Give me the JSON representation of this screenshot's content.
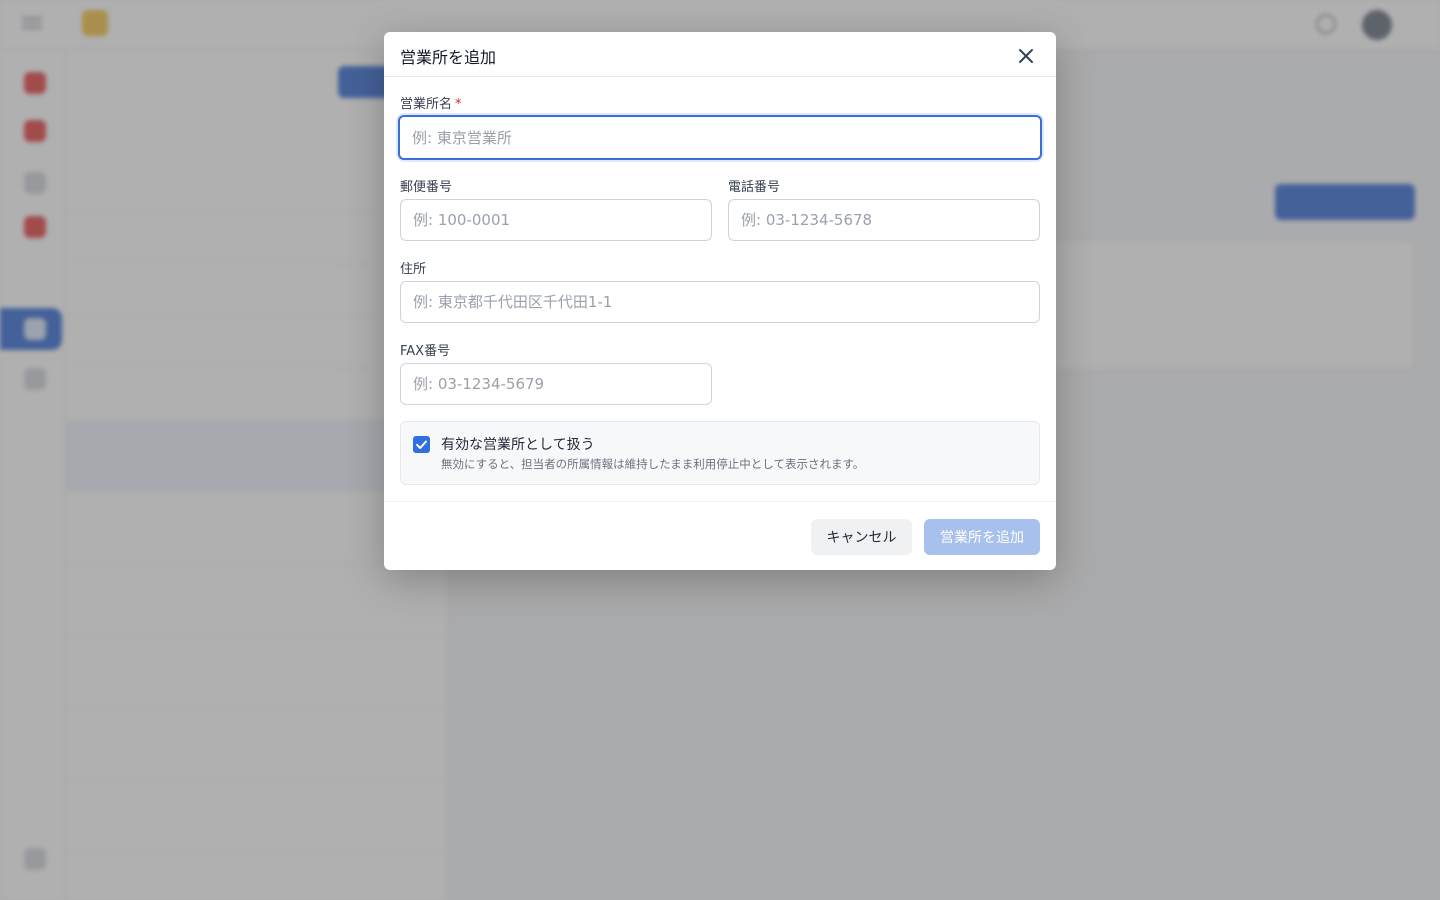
{
  "modal": {
    "title": "営業所を追加",
    "close_icon": "close-icon",
    "fields": {
      "name": {
        "label": "営業所名",
        "required_mark": "*",
        "placeholder": "例: 東京営業所",
        "value": ""
      },
      "postal": {
        "label": "郵便番号",
        "placeholder": "例: 100-0001",
        "value": ""
      },
      "phone": {
        "label": "電話番号",
        "placeholder": "例: 03-1234-5678",
        "value": ""
      },
      "address": {
        "label": "住所",
        "placeholder": "例: 東京都千代田区千代田1-1",
        "value": ""
      },
      "fax": {
        "label": "FAX番号",
        "placeholder": "例: 03-1234-5679",
        "value": ""
      }
    },
    "active_toggle": {
      "checked": true,
      "label": "有効な営業所として扱う",
      "hint": "無効にすると、担当者の所属情報は維持したまま利用停止中として表示されます。"
    },
    "buttons": {
      "cancel": "キャンセル",
      "submit": "営業所を追加"
    }
  },
  "colors": {
    "accent": "#3b6fd8",
    "submit_disabled": "#a7c0ec",
    "required": "#dc2626",
    "overlay": "rgba(80,80,80,0.45)"
  }
}
